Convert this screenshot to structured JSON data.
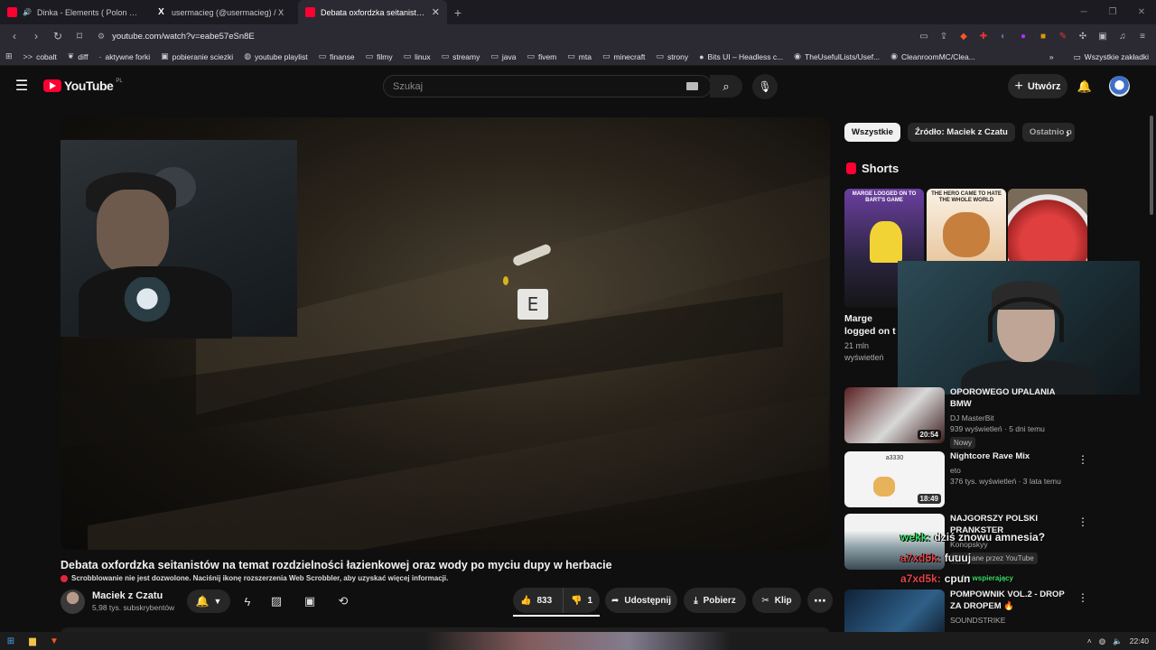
{
  "browser": {
    "tabs": [
      {
        "title": "Dinka - Elements ( Polon Remix )",
        "icon": "youtube-icon",
        "audio": true
      },
      {
        "title": "usermacieg (@usermacieg) / X",
        "icon": "x-logo-icon"
      },
      {
        "title": "Debata oxfordzka seitanistów na",
        "icon": "youtube-icon",
        "active": true
      }
    ],
    "url": "youtube.com/watch?v=eabe57eSn8E",
    "bookmarks": [
      {
        "label": "cobalt",
        "icon": "cobalt-icon"
      },
      {
        "label": "diff",
        "icon": "leaf-icon"
      },
      {
        "label": "aktywne forki",
        "icon": "dot-icon"
      },
      {
        "label": "pobieranie sciezki",
        "icon": "download-icon"
      },
      {
        "label": "youtube playlist",
        "icon": "globe-icon"
      },
      {
        "label": "finanse",
        "icon": "folder-icon"
      },
      {
        "label": "filmy",
        "icon": "folder-icon"
      },
      {
        "label": "linux",
        "icon": "folder-icon"
      },
      {
        "label": "streamy",
        "icon": "folder-icon"
      },
      {
        "label": "java",
        "icon": "folder-icon"
      },
      {
        "label": "fivem",
        "icon": "folder-icon"
      },
      {
        "label": "mta",
        "icon": "folder-icon"
      },
      {
        "label": "minecraft",
        "icon": "folder-icon"
      },
      {
        "label": "strony",
        "icon": "folder-icon"
      },
      {
        "label": "Bits UI – Headless c...",
        "icon": "circle-icon"
      },
      {
        "label": "TheUsefulLists/Usef...",
        "icon": "github-icon"
      },
      {
        "label": "CleanroomMC/Clea...",
        "icon": "github-icon"
      }
    ],
    "bookmarks_all": "Wszystkie zakładki"
  },
  "yt": {
    "logo": "YouTube",
    "country": "PL",
    "search_placeholder": "Szukaj",
    "create_label": "Utwórz"
  },
  "video": {
    "title": "Debata oxfordzka seitanistów na temat rozdzielności łazienkowej oraz wody po myciu dupy w herbacie",
    "scrobble_note": "Scrobblowanie nie jest dozwolone. Naciśnij ikonę rozszerzenia Web Scrobbler, aby uzyskać więcej informacji.",
    "key_prompt": "E",
    "channel": "Maciek z Czatu",
    "subscribers": "5,98 tys. subskrybentów",
    "likes": "833",
    "dislikes": "1",
    "share_label": "Udostępnij",
    "download_label": "Pobierz",
    "clip_label": "Klip"
  },
  "sidebar": {
    "chips": [
      "Wszystkie",
      "Źródło: Maciek z Czatu",
      "Ostatnio p"
    ],
    "shorts_label": "Shorts",
    "shorts": [
      {
        "caption": "Marge logged on to Bart's game",
        "color": "#6b3fa0"
      },
      {
        "caption": "The hero came to hate the whole world",
        "color": "#e9d3b6"
      },
      {
        "caption": "",
        "color": "#c33a3a"
      }
    ],
    "short_meta": {
      "title": "Marge logged on t",
      "views": "21 mln wyświetleń"
    },
    "recs": [
      {
        "title": "OPOROWEGO UPALANIA BMW",
        "channel": "DJ MasterBit",
        "meta": "939 wyświetleń · 5 dni temu",
        "badge": "Nowy",
        "duration": "20:54",
        "color": "#7a2b2b"
      },
      {
        "title": "Nightcore Rave Mix",
        "channel": "eto",
        "meta": "376 tys. wyświetleń · 3 lata temu",
        "badge": "",
        "duration": "18:49",
        "color": "#f2f2f2"
      },
      {
        "title": "NAJGORSZY POLSKI PRANKSTER",
        "channel": "Konopskyy",
        "meta": "Polecane przez YouTube",
        "badge": "",
        "duration": "",
        "color": "#6b7f8c"
      },
      {
        "title": "POMPOWNIK VOL.2 - DROP ZA DROPEM 🔥",
        "channel": "SOUNDSTRIKE",
        "meta": "",
        "badge": "",
        "duration": "",
        "color": "#1d3a5a"
      }
    ],
    "thumb_text": "a3330"
  },
  "chat_overlay": [
    {
      "user": "wekk:",
      "msg": "dziś znowu amnesia?",
      "color": "#3ee06a"
    },
    {
      "user": "a7xd5k:",
      "msg": "fuuuj",
      "color": "#e2454a"
    },
    {
      "user": "",
      "msg": "ko wspierający",
      "color": "#3ee06a"
    },
    {
      "user": "a7xd5k:",
      "msg": "cpun",
      "color": "#e2454a"
    }
  ],
  "taskbar": {
    "clock": "22:40"
  }
}
